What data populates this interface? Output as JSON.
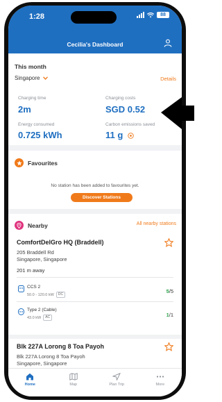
{
  "status": {
    "time": "1:28",
    "battery": "88"
  },
  "header": {
    "title": "Cecilia's Dashboard"
  },
  "month": {
    "title": "This month",
    "region": "Singapore",
    "details_label": "Details",
    "charging_time_label": "Charging time",
    "charging_time_value": "2m",
    "charging_costs_label": "Charging costs",
    "charging_costs_value": "SGD 0.52",
    "energy_label": "Energy consumed",
    "energy_value": "0.725 kWh",
    "carbon_label": "Carbon emissions saved",
    "carbon_value": "11 g"
  },
  "favourites": {
    "title": "Favourites",
    "empty_text": "No station has been added to favourites yet.",
    "discover_label": "Discover Stations"
  },
  "nearby": {
    "title": "Nearby",
    "all_label": "All nearby stations",
    "stations": [
      {
        "name": "ComfortDelGro HQ (Braddell)",
        "address_line1": "205 Braddell Rd",
        "address_line2": "Singapore, Singapore",
        "distance": "201 m away",
        "connectors": [
          {
            "name": "CCS 2",
            "power": "50.0 - 120.0 kW",
            "type": "DC",
            "available": "5",
            "total": "/5"
          },
          {
            "name": "Type 2 (Cable)",
            "power": "43.0 kW",
            "type": "AC",
            "available": "1",
            "total": "/1"
          }
        ]
      },
      {
        "name": "Blk 227A Lorong 8 Toa Payoh",
        "address_line1": "Blk 227A Lorong 8 Toa Payoh",
        "address_line2": "Singapore, Singapore"
      }
    ]
  },
  "nav": {
    "home": "Home",
    "map": "Map",
    "plan_trip": "Plan Trip",
    "more": "More"
  },
  "colors": {
    "brand_blue": "#1f6fc1",
    "accent_orange": "#f07a1a",
    "available_green": "#2aa24a",
    "nearby_pink": "#e0357f"
  }
}
